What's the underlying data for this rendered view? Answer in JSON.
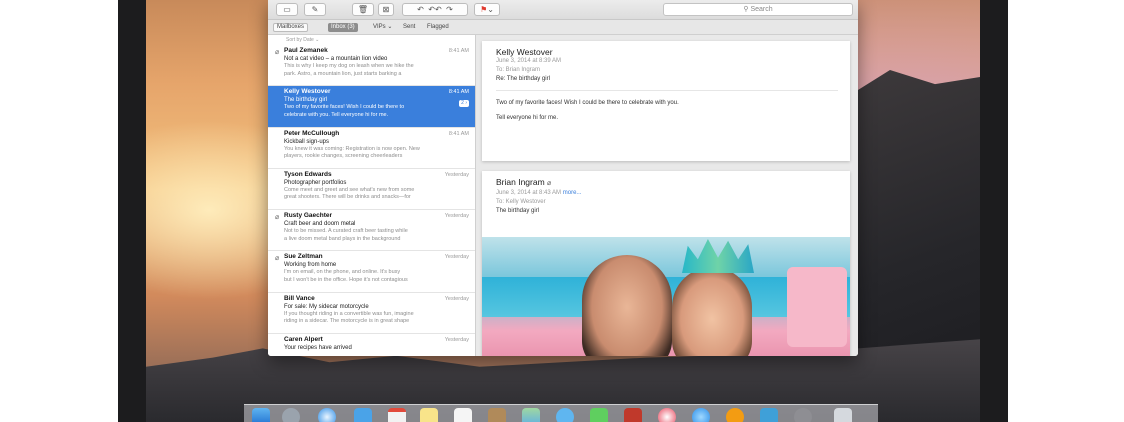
{
  "toolbar": {
    "search_placeholder": "Search"
  },
  "favorites": [
    {
      "label": "Mailboxes"
    },
    {
      "label": "Inbox (3)"
    },
    {
      "label": "VIPs ⌄"
    },
    {
      "label": "Sent"
    },
    {
      "label": "Flagged"
    }
  ],
  "list": {
    "sort_label": "Sort by Date ⌄",
    "items": [
      {
        "from": "Paul Zemanek",
        "time": "8:41 AM",
        "subject": "Not a cat video – a mountain lion video",
        "preview1": "This is why I keep my dog on leash when we hike the",
        "preview2": "park. Astro, a mountain lion, just starts barking a"
      },
      {
        "from": "Kelly Westover",
        "time": "8:41 AM",
        "subject": "The birthday girl",
        "preview1": "Two of my favorite faces! Wish I could be there to",
        "preview2": "celebrate with you. Tell everyone hi for me."
      },
      {
        "from": "Peter McCullough",
        "time": "8:41 AM",
        "subject": "Kickball sign-ups",
        "preview1": "You knew it was coming: Registration is now open. New",
        "preview2": "players, rookie changes, screening cheerleaders"
      },
      {
        "from": "Tyson Edwards",
        "time": "Yesterday",
        "subject": "Photographer portfolios",
        "preview1": "Come meet and greet and see what's new from some",
        "preview2": "great shooters. There will be drinks and snacks—for"
      },
      {
        "from": "Rusty Gaechter",
        "time": "Yesterday",
        "subject": "Craft beer and doom metal",
        "preview1": "Not to be missed. A curated craft beer tasting while",
        "preview2": "a live doom metal band plays in the background"
      },
      {
        "from": "Sue Zeltman",
        "time": "Yesterday",
        "subject": "Working from home",
        "preview1": "I'm on email, on the phone, and online. It's busy",
        "preview2": "but I won't be in the office. Hope it's not contagious"
      },
      {
        "from": "Bill Vance",
        "time": "Yesterday",
        "subject": "For sale: My sidecar motorcycle",
        "preview1": "If you thought riding in a convertible was fun, imagine",
        "preview2": "riding in a sidecar. The motorcycle is in great shape"
      },
      {
        "from": "Caren Alpert",
        "time": "Yesterday",
        "subject": "Your recipes have arrived",
        "preview1": "",
        "preview2": ""
      }
    ]
  },
  "reader": {
    "message1": {
      "sender": "Kelly Westover",
      "date": "June 3, 2014 at 8:39 AM",
      "to": "To: Brian Ingram",
      "re": "Re: The birthday girl",
      "body1": "Two of my favorite faces! Wish I could be there to celebrate with you.",
      "body2": "Tell everyone hi for me."
    },
    "message2": {
      "sender": "Brian Ingram",
      "date": "June 3, 2014 at 8:43 AM",
      "more": "more...",
      "to": "To: Kelly Westover",
      "subject": "The birthday girl"
    }
  },
  "dock": {
    "icons": [
      "finder-icon",
      "launchpad-icon",
      "safari-icon",
      "mail-icon",
      "calendar-icon",
      "notes-icon",
      "reminders-icon",
      "contacts-icon",
      "maps-icon",
      "messages-icon",
      "facetime-icon",
      "photo-booth-icon",
      "itunes-icon",
      "app-store-icon",
      "ibooks-icon",
      "preview-icon",
      "settings-icon",
      "trash-icon"
    ]
  }
}
